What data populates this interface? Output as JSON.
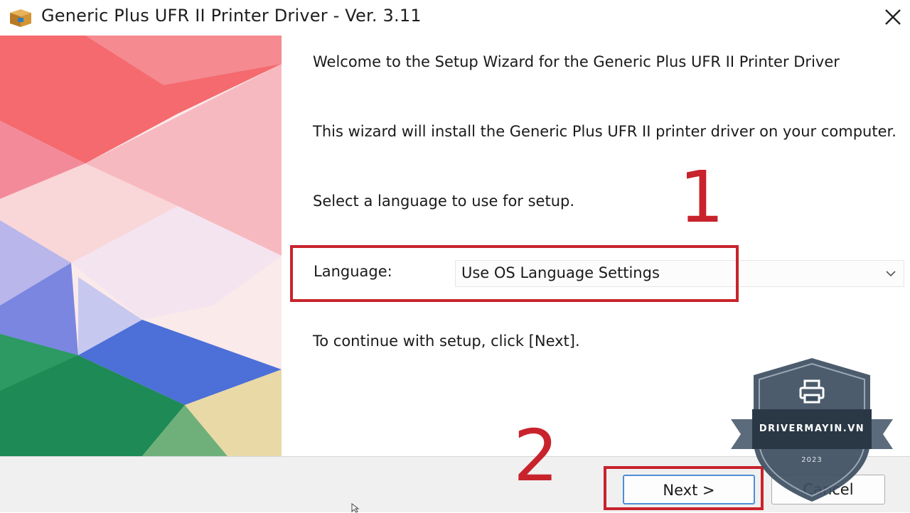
{
  "window": {
    "title": "Generic Plus UFR II Printer Driver - Ver. 3.11",
    "icon": "package-icon",
    "close_icon": "close-icon"
  },
  "wizard": {
    "welcome": "Welcome to the Setup Wizard for the Generic Plus UFR II Printer Driver",
    "description": "This wizard will install the Generic Plus UFR II printer driver on your computer.",
    "select_language_prompt": "Select a language to use for setup.",
    "language_label": "Language:",
    "language_value": "Use OS Language Settings",
    "continue_text": "To continue with setup, click [Next]."
  },
  "buttons": {
    "next": "Next >",
    "cancel": "Cancel"
  },
  "annotations": {
    "step1": "1",
    "step2": "2",
    "highlight_color": "#c8232c"
  },
  "watermark": {
    "site": "DRIVERMAYIN.VN",
    "year": "2023",
    "icon": "printer-icon"
  }
}
